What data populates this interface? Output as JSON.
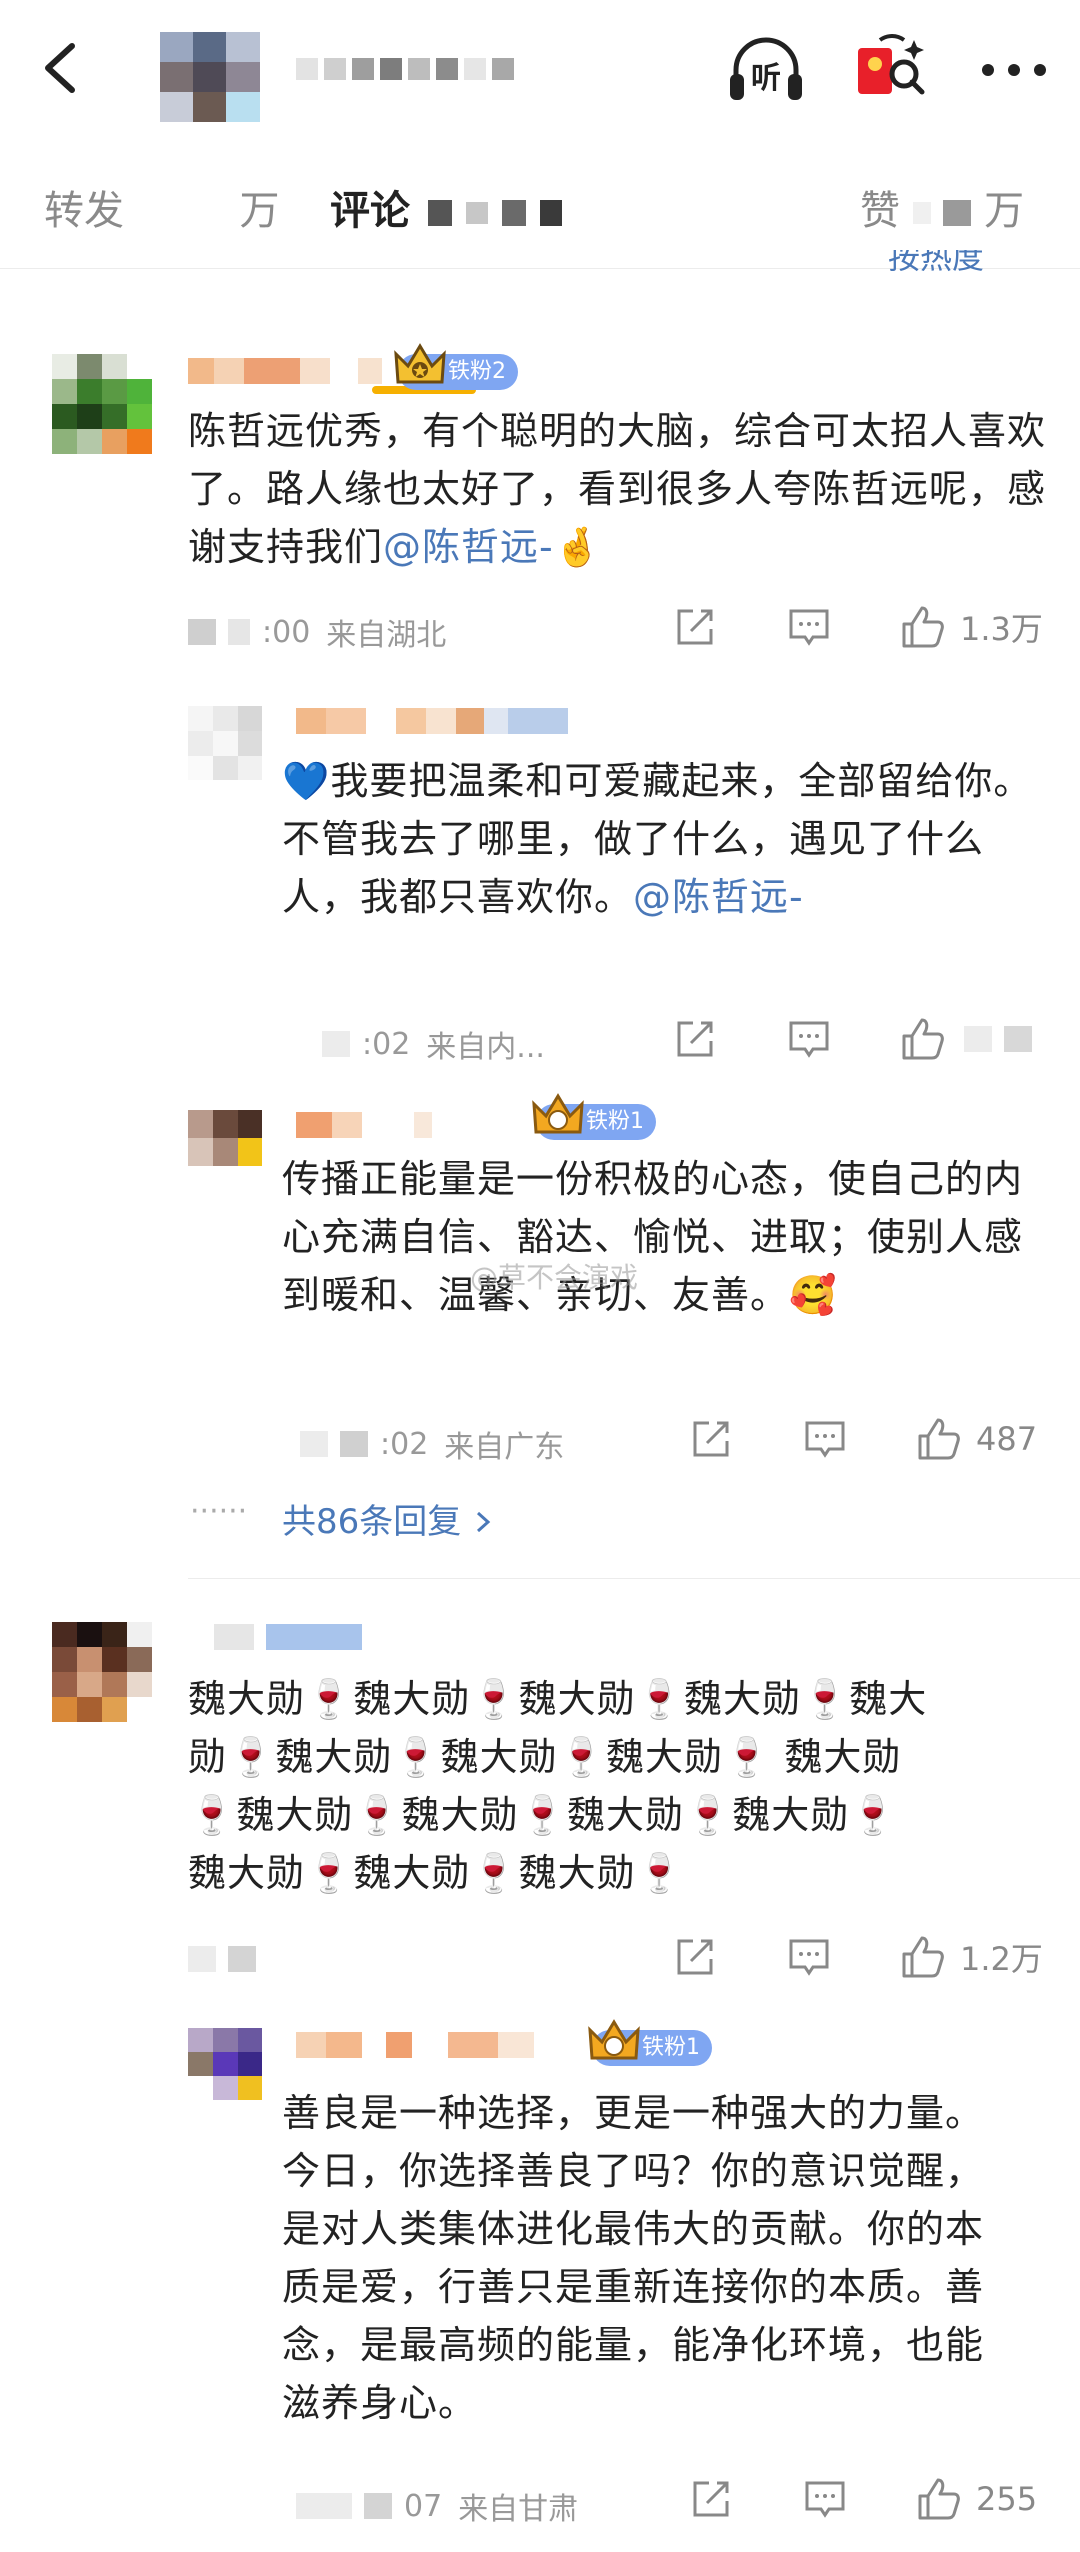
{
  "tabs": {
    "repost": "转发",
    "repost_unit": "万",
    "comments": "评论",
    "likes": "赞",
    "likes_unit": "万"
  },
  "sort_hint": "按热度",
  "header_icons": {
    "listen": "听",
    "listen_icon": "headphones-icon",
    "redpacket_icon": "red-packet-icon",
    "more_icon": "more-icon"
  },
  "comments": [
    {
      "badge": "铁粉2",
      "text_pre": "陈哲远优秀，有个聪明的大脑，综合可太招人喜欢了。路人缘也太好了，看到很多人夸陈哲远呢，感谢支持我们",
      "mention": "@陈哲远-",
      "emoji": "🤞",
      "time": ":00",
      "location": "来自湖北",
      "likes": "1.3万",
      "replies": [
        {
          "text_pre": "💙我要把温柔和可爱藏起来，全部留给你。不管我去了哪里，做了什么，遇见了什么人，我都只喜欢你。",
          "mention": "@陈哲远-",
          "time": ":02",
          "location": "来自内...",
          "likes": ""
        },
        {
          "badge": "铁粉1",
          "text": "传播正能量是一份积极的心态，使自己的内心充满自信、豁达、愉悦、进取；使别人感到暖和、温馨、亲切、友善。",
          "emoji": "🥰",
          "time": ":02",
          "location": "来自广东",
          "likes": "487",
          "watermark": "@草不会演戏"
        }
      ],
      "reply_count_label": "共86条回复",
      "dots": "······"
    },
    {
      "text_lines": [
        "魏大勋🍷魏大勋🍷魏大勋🍷魏大勋🍷魏大",
        "勋🍷魏大勋🍷魏大勋🍷魏大勋🍷 魏大勋",
        "🍷魏大勋🍷魏大勋🍷魏大勋🍷魏大勋🍷",
        "魏大勋🍷魏大勋🍷魏大勋🍷"
      ],
      "likes": "1.2万",
      "replies": [
        {
          "badge": "铁粉1",
          "text": "善良是一种选择，更是一种强大的力量。今日，你选择善良了吗？你的意识觉醒，是对人类集体进化最伟大的贡献。你的本质是爱，行善只是重新连接你的本质。善念，是最高频的能量，能净化环境，也能滋养身心。",
          "time": "07",
          "location": "来自甘肃",
          "likes": "255"
        }
      ]
    }
  ],
  "colors": {
    "link": "#4a78b8",
    "badge": "#7fa6f2",
    "tab_underline": "#f6b000"
  }
}
